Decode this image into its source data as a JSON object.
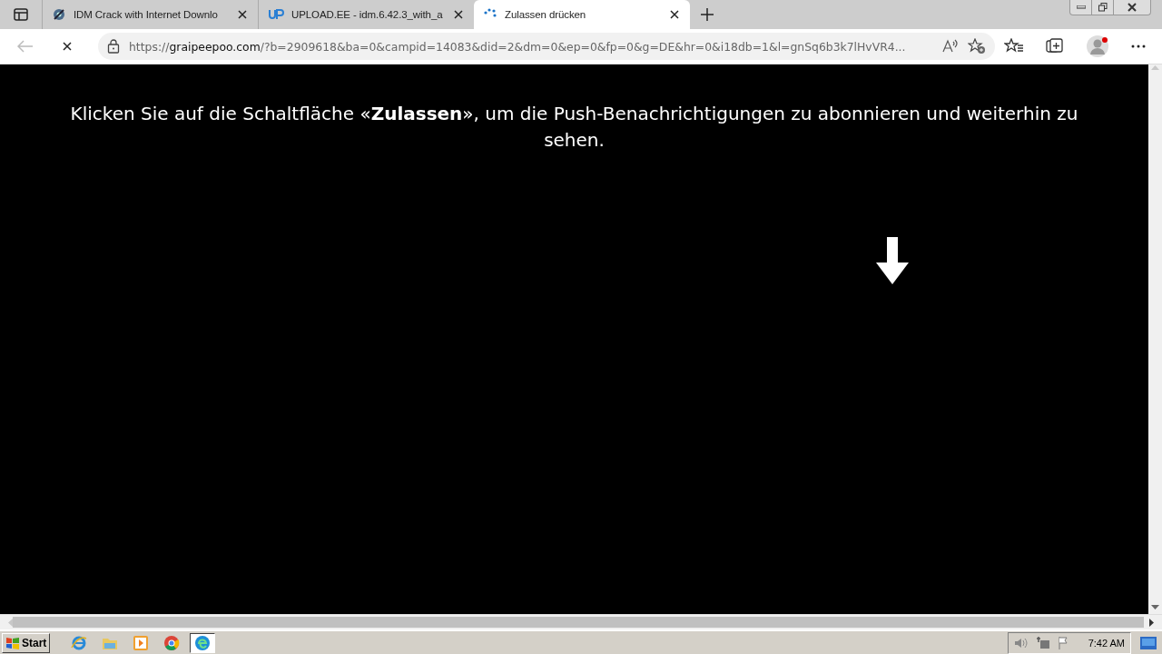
{
  "tabs": [
    {
      "title": "IDM Crack with Internet Downlo",
      "kind": "gear",
      "selected": false
    },
    {
      "title": "UPLOAD.EE - idm.6.42.3_with_a",
      "kind": "up",
      "selected": false
    },
    {
      "title": "Zulassen drücken",
      "kind": "loading",
      "selected": true
    }
  ],
  "address_bar": {
    "host": "graipeepoo.com",
    "url_prefix": "https://",
    "url_rest": "/?b=2909618&ba=0&campid=14083&did=2&dm=0&ep=0&fp=0&g=DE&hr=0&i18db=1&l=gnSq6b3k7lHvVR4..."
  },
  "page": {
    "message": "Klicken Sie auf die Schaltfläche «**Zulassen**», um die Push-Benachrichtigungen zu abonnieren und weiterhin zu sehen."
  },
  "taskbar": {
    "start": "Start",
    "apps": [
      {
        "kind": "ie",
        "selected": false
      },
      {
        "kind": "folder",
        "selected": false
      },
      {
        "kind": "media",
        "selected": false
      },
      {
        "kind": "chrome",
        "selected": false
      },
      {
        "kind": "edge",
        "selected": true
      }
    ],
    "clock": "7:42 AM"
  }
}
